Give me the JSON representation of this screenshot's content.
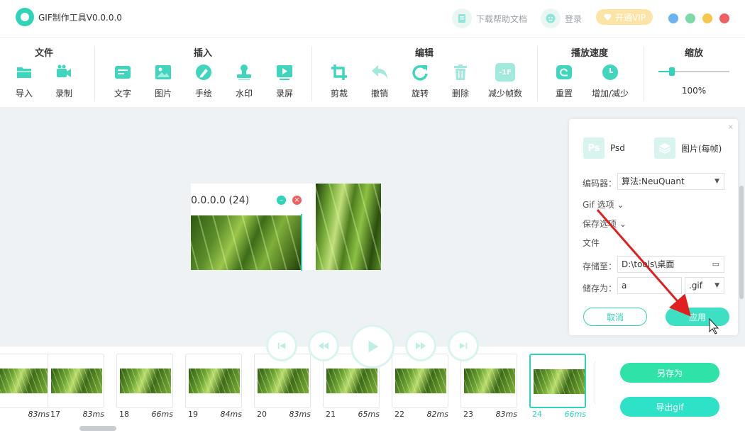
{
  "app": {
    "title": "GIF制作工具V0.0.0.0"
  },
  "titlebar": {
    "help_label": "下载帮助文档",
    "login_label": "登录",
    "vip_label": "开通VIP",
    "colors": {
      "minimize": "#6ab4f2",
      "maximize": "#f6c74c",
      "close": "#f06060"
    }
  },
  "toolbar": {
    "groups": {
      "file": "文件",
      "insert": "插入",
      "edit": "编辑",
      "speed": "播放速度",
      "zoom": "缩放"
    },
    "tools": {
      "import": "导入",
      "record": "录制",
      "text": "文字",
      "image": "图片",
      "draw": "手绘",
      "watermark": "水印",
      "screen_record": "录屏",
      "crop": "剪裁",
      "undo": "撤销",
      "rotate": "旋转",
      "delete": "删除",
      "reduce_frames": "减少帧数",
      "reset": "重置",
      "speed_adjust": "增加/减少"
    },
    "reduce_frames_badge": "-1F",
    "zoom_value": "100%",
    "zoom_level": 0.2
  },
  "preview": {
    "window_title": "0.0.0.0 (24)"
  },
  "panel": {
    "close_glyph": "×",
    "psd_icon_text": "Ps",
    "psd_label": "Psd",
    "images_label": "图片(每帧)",
    "encoder_label": "编码器：",
    "encoder_value": "算法:NeuQuant",
    "gif_options": "Gif 选项",
    "save_options": "保存选项",
    "file_section": "文件",
    "save_to_label": "存储至：",
    "save_to_value": "D:\\tools\\桌面",
    "save_as_label": "储存为：",
    "filename_value": "a",
    "extension_value": ".gif",
    "cancel_label": "取消",
    "apply_label": "应用"
  },
  "timeline": {
    "frames": [
      {
        "num": "",
        "dur": "83ms"
      },
      {
        "num": "17",
        "dur": "83ms"
      },
      {
        "num": "18",
        "dur": "66ms"
      },
      {
        "num": "19",
        "dur": "84ms"
      },
      {
        "num": "20",
        "dur": "83ms"
      },
      {
        "num": "21",
        "dur": "65ms"
      },
      {
        "num": "22",
        "dur": "82ms"
      },
      {
        "num": "23",
        "dur": "83ms"
      },
      {
        "num": "24",
        "dur": "66ms"
      }
    ],
    "save_as_label": "另存为",
    "export_label": "导出gif"
  },
  "colors": {
    "accent": "#2fd3b8",
    "canvas_bg": "#eef2f5",
    "annotation_arrow": "#e02020"
  }
}
